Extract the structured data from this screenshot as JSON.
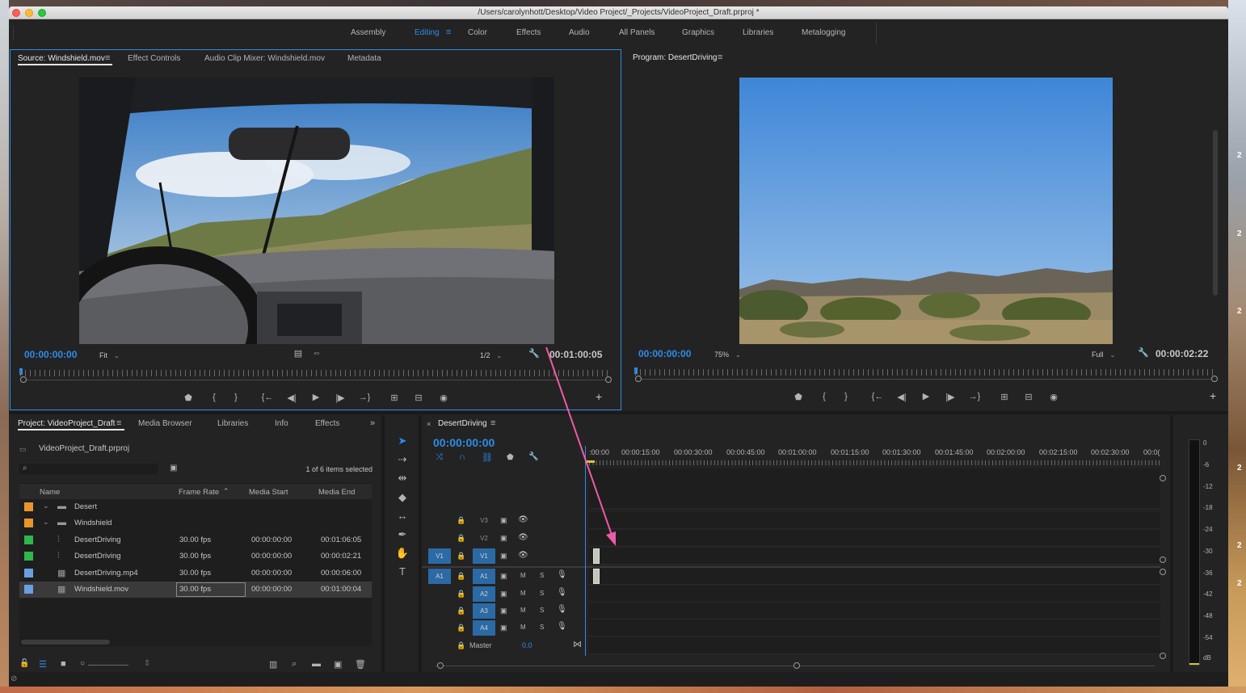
{
  "window": {
    "title": "/Users/carolynhott/Desktop/Video Project/_Projects/VideoProject_Draft.prproj *"
  },
  "workspaces": [
    "Assembly",
    "Editing",
    "Color",
    "Effects",
    "Audio",
    "All Panels",
    "Graphics",
    "Libraries",
    "Metalogging"
  ],
  "source": {
    "tabs": [
      "Source: Windshield.mov",
      "Effect Controls",
      "Audio Clip Mixer: Windshield.mov",
      "Metadata"
    ],
    "timecode": "00:00:00:00",
    "fit": "Fit",
    "resolution": "1/2",
    "duration": "00:01:00:05"
  },
  "program": {
    "tab": "Program: DesertDriving",
    "timecode": "00:00:00:00",
    "zoom": "75%",
    "resolution": "Full",
    "duration": "00:00:02:22"
  },
  "project": {
    "tabs": [
      "Project: VideoProject_Draft",
      "Media Browser",
      "Libraries",
      "Info",
      "Effects"
    ],
    "file": "VideoProject_Draft.prproj",
    "items_selected": "1 of 6 items selected",
    "columns": [
      "Name",
      "Frame Rate",
      "Media Start",
      "Media End"
    ],
    "rows": [
      {
        "name": "Desert",
        "type": "bin",
        "color": "#e8952a",
        "frame_rate": "",
        "media_start": "",
        "media_end": ""
      },
      {
        "name": "Windshield",
        "type": "bin",
        "color": "#e8952a",
        "frame_rate": "",
        "media_start": "",
        "media_end": ""
      },
      {
        "name": "DesertDriving",
        "type": "sequence",
        "color": "#2eb84a",
        "frame_rate": "30.00 fps",
        "media_start": "00:00:00:00",
        "media_end": "00:01:06:05"
      },
      {
        "name": "DesertDriving",
        "type": "sequence",
        "color": "#2eb84a",
        "frame_rate": "30.00 fps",
        "media_start": "00:00:00:00",
        "media_end": "00:00:02:21"
      },
      {
        "name": "DesertDriving.mp4",
        "type": "clip",
        "color": "#6a9ee0",
        "frame_rate": "30.00 fps",
        "media_start": "00:00:00:00",
        "media_end": "00:00:06:00"
      },
      {
        "name": "Windshield.mov",
        "type": "clip",
        "color": "#6a9ee0",
        "frame_rate": "30.00 fps",
        "media_start": "00:00:00:00",
        "media_end": "00:01:00:04"
      }
    ]
  },
  "timeline": {
    "tab": "DesertDriving",
    "timecode": "00:00:00:00",
    "ruler": [
      ":00:00",
      "00:00:15:00",
      "00:00:30:00",
      "00:00:45:00",
      "00:01:00:00",
      "00:01:15:00",
      "00:01:30:00",
      "00:01:45:00",
      "00:02:00:00",
      "00:02:15:00",
      "00:02:30:00",
      "00:0("
    ],
    "video_tracks": [
      "V3",
      "V2",
      "V1"
    ],
    "audio_tracks": [
      "A1",
      "A2",
      "A3",
      "A4"
    ],
    "source_video": "V1",
    "source_audio": "A1",
    "master_label": "Master",
    "master_value": "0.0",
    "mute": "M",
    "solo": "S"
  },
  "meter": {
    "scale": [
      "0",
      "-6",
      "-12",
      "-18",
      "-24",
      "-30",
      "-36",
      "-42",
      "-48",
      "-54",
      "dB"
    ]
  },
  "desktop_digits": [
    "2",
    "2",
    "2",
    "2",
    "2",
    "2"
  ],
  "colors": {
    "accent": "#2d8ceb",
    "annotation_arrow": "#ee5aa8"
  }
}
